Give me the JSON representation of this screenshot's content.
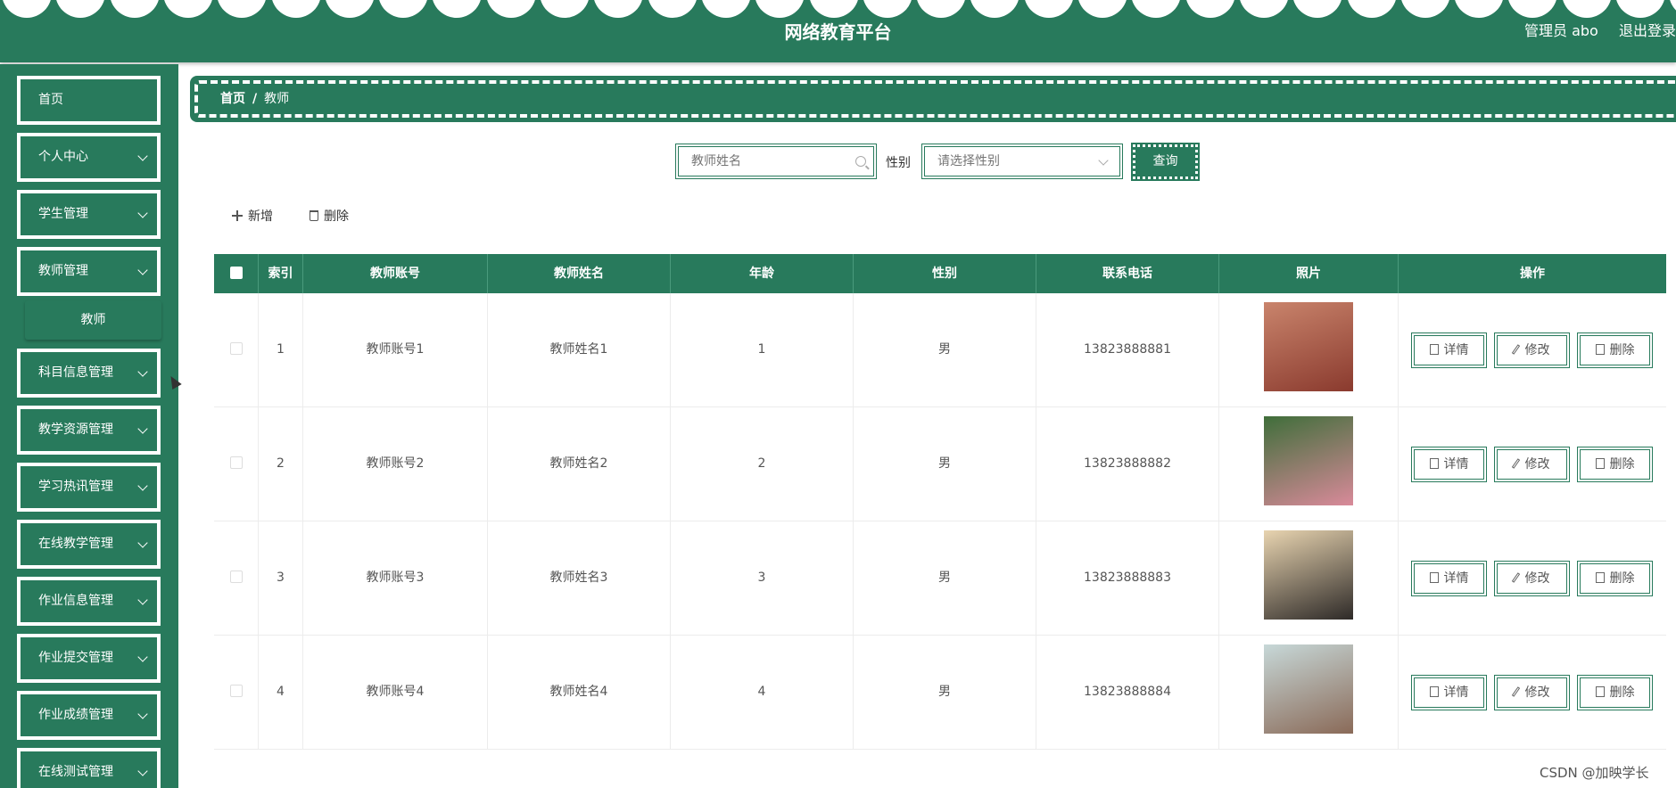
{
  "header": {
    "title": "网络教育平台",
    "user": "管理员 abo",
    "logout": "退出登录"
  },
  "sidebar": {
    "items": [
      {
        "label": "首页",
        "has_children": false
      },
      {
        "label": "个人中心",
        "has_children": true
      },
      {
        "label": "学生管理",
        "has_children": true
      },
      {
        "label": "教师管理",
        "has_children": true
      },
      {
        "label": "科目信息管理",
        "has_children": true
      },
      {
        "label": "教学资源管理",
        "has_children": true
      },
      {
        "label": "学习热讯管理",
        "has_children": true
      },
      {
        "label": "在线教学管理",
        "has_children": true
      },
      {
        "label": "作业信息管理",
        "has_children": true
      },
      {
        "label": "作业提交管理",
        "has_children": true
      },
      {
        "label": "作业成绩管理",
        "has_children": true
      },
      {
        "label": "在线测试管理",
        "has_children": true
      }
    ],
    "submenu": {
      "label": "教师"
    }
  },
  "breadcrumb": {
    "home": "首页",
    "separator": "/",
    "current": "教师"
  },
  "search": {
    "name_placeholder": "教师姓名",
    "gender_label": "性别",
    "gender_placeholder": "请选择性别",
    "query_label": "查询"
  },
  "actions": {
    "add_label": "新增",
    "delete_label": "删除"
  },
  "table": {
    "columns": [
      "索引",
      "教师账号",
      "教师姓名",
      "年龄",
      "性别",
      "联系电话",
      "照片",
      "操作"
    ],
    "rows": [
      {
        "index": "1",
        "account": "教师账号1",
        "name": "教师姓名1",
        "age": "1",
        "gender": "男",
        "phone": "13823888881"
      },
      {
        "index": "2",
        "account": "教师账号2",
        "name": "教师姓名2",
        "age": "2",
        "gender": "男",
        "phone": "13823888882"
      },
      {
        "index": "3",
        "account": "教师账号3",
        "name": "教师姓名3",
        "age": "3",
        "gender": "男",
        "phone": "13823888883"
      },
      {
        "index": "4",
        "account": "教师账号4",
        "name": "教师姓名4",
        "age": "4",
        "gender": "男",
        "phone": "13823888884"
      }
    ],
    "op_labels": {
      "detail": "详情",
      "edit": "修改",
      "delete": "删除"
    }
  },
  "colors": {
    "primary": "#287a5c",
    "white": "#ffffff"
  },
  "watermark": "CSDN @加映学长"
}
